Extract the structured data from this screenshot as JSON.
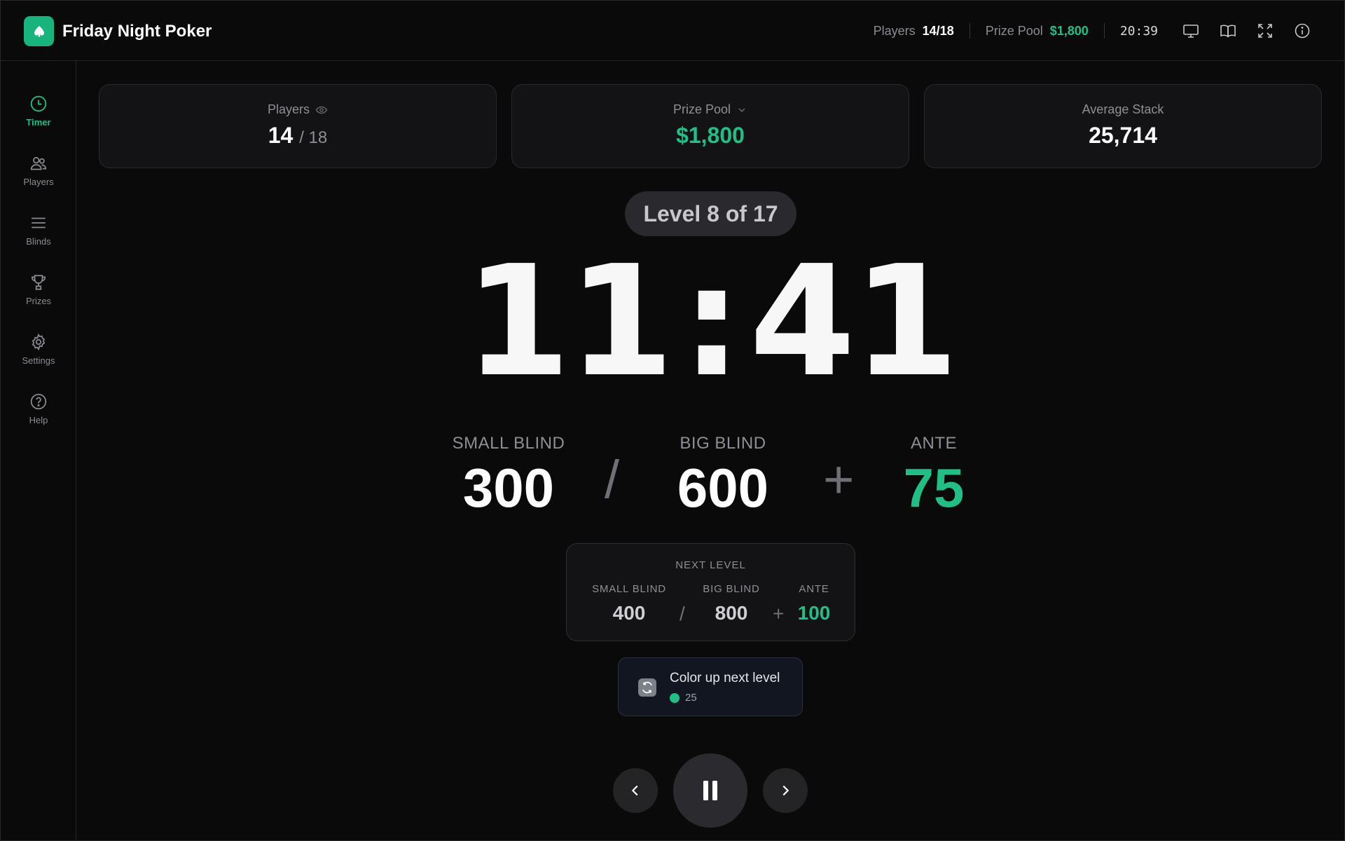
{
  "app": {
    "title": "Friday Night Poker"
  },
  "header": {
    "players_label": "Players",
    "players_value": "14/18",
    "prize_label": "Prize Pool",
    "prize_value": "$1,800",
    "clock": "20:39",
    "icons": [
      "monitor-icon",
      "book-icon",
      "fullscreen-icon",
      "info-icon"
    ]
  },
  "sidebar": {
    "items": [
      {
        "label": "Timer",
        "icon": "clock-icon",
        "active": true
      },
      {
        "label": "Players",
        "icon": "users-icon",
        "active": false
      },
      {
        "label": "Blinds",
        "icon": "menu-lines-icon",
        "active": false
      },
      {
        "label": "Prizes",
        "icon": "trophy-icon",
        "active": false
      },
      {
        "label": "Settings",
        "icon": "gear-icon",
        "active": false
      },
      {
        "label": "Help",
        "icon": "help-circle-icon",
        "active": false
      }
    ]
  },
  "stats": {
    "players": {
      "label": "Players",
      "current": "14",
      "total": "/ 18"
    },
    "prize_pool": {
      "label": "Prize Pool",
      "value": "$1,800"
    },
    "average_stack": {
      "label": "Average Stack",
      "value": "25,714"
    }
  },
  "level": {
    "label": "Level 8 of 17"
  },
  "timer": {
    "minutes": "11",
    "colon": ":",
    "seconds": "41"
  },
  "blinds": {
    "small_label": "SMALL BLIND",
    "small_value": "300",
    "separator": "/",
    "big_label": "BIG BLIND",
    "big_value": "600",
    "plus": "+",
    "ante_label": "ANTE",
    "ante_value": "75"
  },
  "next_level": {
    "title": "NEXT LEVEL",
    "small_label": "SMALL BLIND",
    "small_value": "400",
    "separator": "/",
    "big_label": "BIG BLIND",
    "big_value": "800",
    "plus": "+",
    "ante_label": "ANTE",
    "ante_value": "100"
  },
  "color_up": {
    "title": "Color up next level",
    "chip_value": "25",
    "chip_color": "#1fbf85"
  },
  "controls": {
    "prev": "chevron-left-icon",
    "pause": "pause-icon",
    "next": "chevron-right-icon"
  },
  "colors": {
    "accent": "#1fbf85",
    "background": "#0a0a0b",
    "card": "#131315"
  }
}
